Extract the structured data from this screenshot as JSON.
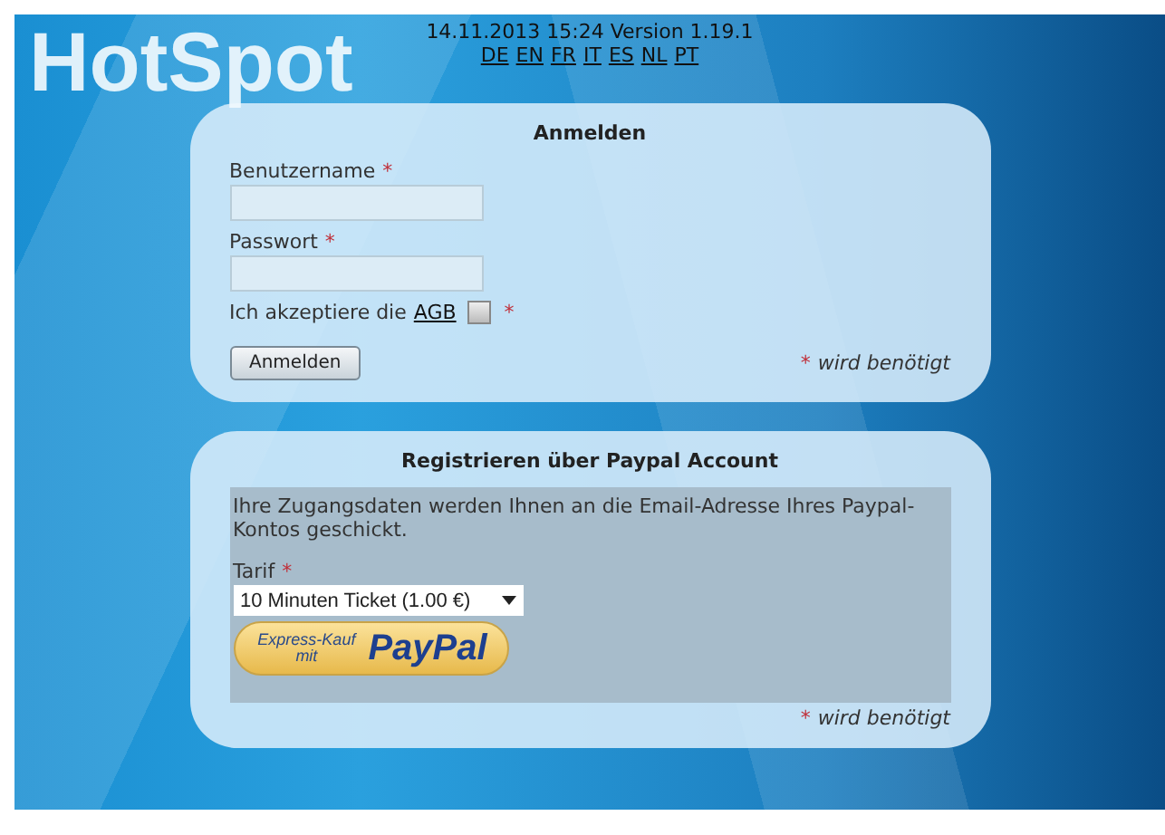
{
  "header": {
    "datetime_version": "14.11.2013 15:24 Version 1.19.1",
    "languages": [
      "DE",
      "EN",
      "FR",
      "IT",
      "ES",
      "NL",
      "PT"
    ]
  },
  "logo": "HotSpot",
  "login": {
    "title": "Anmelden",
    "fields": [
      {
        "label": "Benutzername",
        "required_mark": "*"
      },
      {
        "label": "Passwort",
        "required_mark": "*"
      }
    ],
    "terms": {
      "text": "Ich akzeptiere die",
      "link": "AGB",
      "checked": false,
      "required_mark": "*"
    },
    "button": "Anmelden",
    "required_note": {
      "mark": "*",
      "text": "wird benötigt"
    }
  },
  "register": {
    "title": "Registrieren über Paypal Account",
    "info": "Ihre Zugangsdaten werden Ihnen an die Email-Adresse Ihres Paypal-Kontos geschickt.",
    "tariff": {
      "label": "Tarif",
      "required_mark": "*",
      "value": "10 Minuten Ticket (1.00 €)"
    },
    "paypal_button": {
      "small_text": "Express-Kauf mit",
      "brand": "PayPal"
    },
    "required_note": {
      "mark": "*",
      "text": "wird benötigt"
    }
  }
}
